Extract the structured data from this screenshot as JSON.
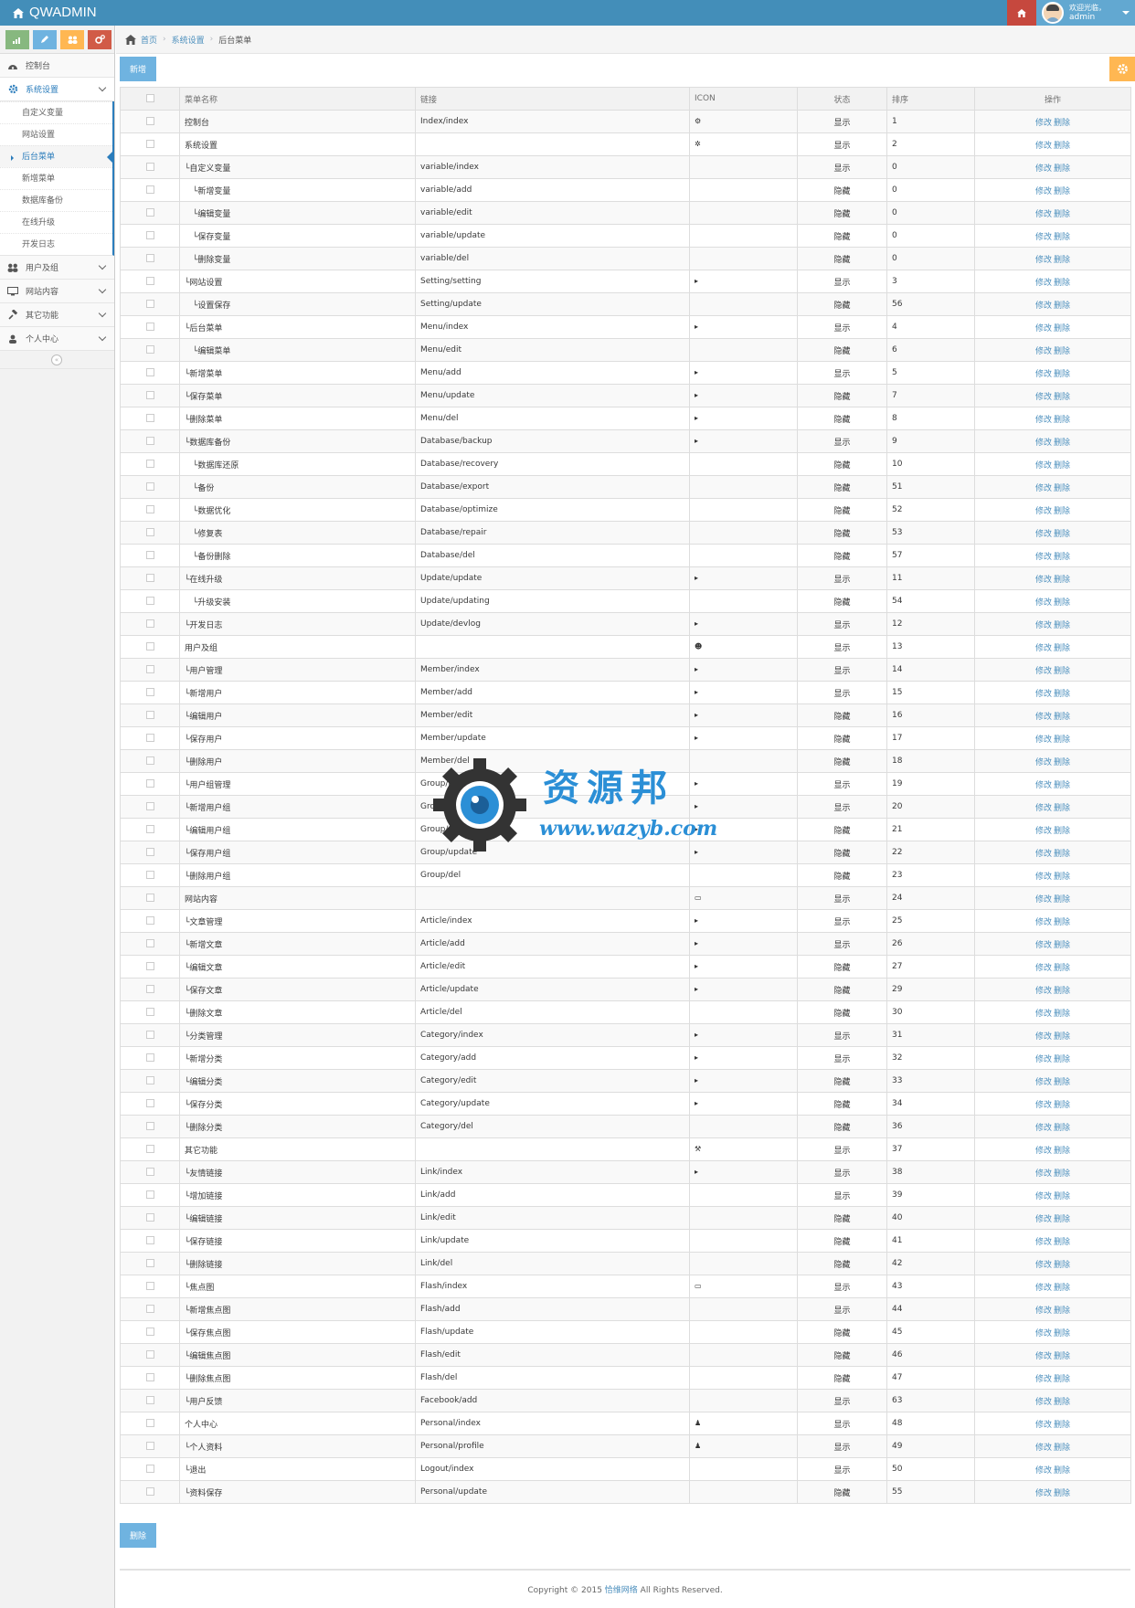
{
  "app": {
    "brand": "QWADMIN",
    "user": {
      "greeting": "欢迎光临，",
      "name": "admin"
    }
  },
  "sidebar": {
    "items": [
      {
        "label": "控制台",
        "icon": "dashboard-icon"
      },
      {
        "label": "系统设置",
        "icon": "cog-icon",
        "active": true
      },
      {
        "label": "用户及组",
        "icon": "users-icon"
      },
      {
        "label": "网站内容",
        "icon": "desktop-icon"
      },
      {
        "label": "其它功能",
        "icon": "gavel-icon"
      },
      {
        "label": "个人中心",
        "icon": "user-icon"
      }
    ],
    "submenu": [
      "自定义变量",
      "网站设置",
      "后台菜单",
      "新增菜单",
      "数据库备份",
      "在线升级",
      "开发日志"
    ],
    "collapse_symbol": "«"
  },
  "breadcrumb": {
    "home": "首页",
    "parent": "系统设置",
    "current": "后台菜单"
  },
  "buttons": {
    "new": "新增",
    "delete": "删除"
  },
  "table": {
    "headers": {
      "name": "菜单名称",
      "link": "链接",
      "icon": "ICON",
      "status": "状态",
      "order": "排序",
      "ops": "操作"
    },
    "ops": {
      "edit": "修改",
      "delete": "删除"
    },
    "rows": [
      {
        "name": "控制台",
        "link": "Index/index",
        "icon": "⚙",
        "status": "显示",
        "order": "1"
      },
      {
        "name": "系统设置",
        "link": "",
        "icon": "✲",
        "status": "显示",
        "order": "2"
      },
      {
        "name": "└自定义变量",
        "link": "variable/index",
        "icon": "",
        "status": "显示",
        "order": "0"
      },
      {
        "name": "　└新增变量",
        "link": "variable/add",
        "icon": "",
        "status": "隐藏",
        "order": "0"
      },
      {
        "name": "　└编辑变量",
        "link": "variable/edit",
        "icon": "",
        "status": "隐藏",
        "order": "0"
      },
      {
        "name": "　└保存变量",
        "link": "variable/update",
        "icon": "",
        "status": "隐藏",
        "order": "0"
      },
      {
        "name": "　└删除变量",
        "link": "variable/del",
        "icon": "",
        "status": "隐藏",
        "order": "0"
      },
      {
        "name": "└网站设置",
        "link": "Setting/setting",
        "icon": "▸",
        "status": "显示",
        "order": "3"
      },
      {
        "name": "　└设置保存",
        "link": "Setting/update",
        "icon": "",
        "status": "隐藏",
        "order": "56"
      },
      {
        "name": "└后台菜单",
        "link": "Menu/index",
        "icon": "▸",
        "status": "显示",
        "order": "4"
      },
      {
        "name": "　└编辑菜单",
        "link": "Menu/edit",
        "icon": "",
        "status": "隐藏",
        "order": "6"
      },
      {
        "name": "└新增菜单",
        "link": "Menu/add",
        "icon": "▸",
        "status": "显示",
        "order": "5"
      },
      {
        "name": "└保存菜单",
        "link": "Menu/update",
        "icon": "▸",
        "status": "隐藏",
        "order": "7"
      },
      {
        "name": "└删除菜单",
        "link": "Menu/del",
        "icon": "▸",
        "status": "隐藏",
        "order": "8"
      },
      {
        "name": "└数据库备份",
        "link": "Database/backup",
        "icon": "▸",
        "status": "显示",
        "order": "9"
      },
      {
        "name": "　└数据库还原",
        "link": "Database/recovery",
        "icon": "",
        "status": "隐藏",
        "order": "10"
      },
      {
        "name": "　└备份",
        "link": "Database/export",
        "icon": "",
        "status": "隐藏",
        "order": "51"
      },
      {
        "name": "　└数据优化",
        "link": "Database/optimize",
        "icon": "",
        "status": "隐藏",
        "order": "52"
      },
      {
        "name": "　└修复表",
        "link": "Database/repair",
        "icon": "",
        "status": "隐藏",
        "order": "53"
      },
      {
        "name": "　└备份删除",
        "link": "Database/del",
        "icon": "",
        "status": "隐藏",
        "order": "57"
      },
      {
        "name": "└在线升级",
        "link": "Update/update",
        "icon": "▸",
        "status": "显示",
        "order": "11"
      },
      {
        "name": "　└升级安装",
        "link": "Update/updating",
        "icon": "",
        "status": "隐藏",
        "order": "54"
      },
      {
        "name": "└开发日志",
        "link": "Update/devlog",
        "icon": "▸",
        "status": "显示",
        "order": "12"
      },
      {
        "name": "用户及组",
        "link": "",
        "icon": "☻",
        "status": "显示",
        "order": "13"
      },
      {
        "name": "└用户管理",
        "link": "Member/index",
        "icon": "▸",
        "status": "显示",
        "order": "14"
      },
      {
        "name": "└新增用户",
        "link": "Member/add",
        "icon": "▸",
        "status": "显示",
        "order": "15"
      },
      {
        "name": "└编辑用户",
        "link": "Member/edit",
        "icon": "▸",
        "status": "隐藏",
        "order": "16"
      },
      {
        "name": "└保存用户",
        "link": "Member/update",
        "icon": "▸",
        "status": "隐藏",
        "order": "17"
      },
      {
        "name": "└删除用户",
        "link": "Member/del",
        "icon": "",
        "status": "隐藏",
        "order": "18"
      },
      {
        "name": "└用户组管理",
        "link": "Group/index",
        "icon": "▸",
        "status": "显示",
        "order": "19"
      },
      {
        "name": "└新增用户组",
        "link": "Group/add",
        "icon": "▸",
        "status": "显示",
        "order": "20"
      },
      {
        "name": "└编辑用户组",
        "link": "Group/edit",
        "icon": "▸",
        "status": "隐藏",
        "order": "21"
      },
      {
        "name": "└保存用户组",
        "link": "Group/update",
        "icon": "▸",
        "status": "隐藏",
        "order": "22"
      },
      {
        "name": "└删除用户组",
        "link": "Group/del",
        "icon": "",
        "status": "隐藏",
        "order": "23"
      },
      {
        "name": "网站内容",
        "link": "",
        "icon": "▭",
        "status": "显示",
        "order": "24"
      },
      {
        "name": "└文章管理",
        "link": "Article/index",
        "icon": "▸",
        "status": "显示",
        "order": "25"
      },
      {
        "name": "└新增文章",
        "link": "Article/add",
        "icon": "▸",
        "status": "显示",
        "order": "26"
      },
      {
        "name": "└编辑文章",
        "link": "Article/edit",
        "icon": "▸",
        "status": "隐藏",
        "order": "27"
      },
      {
        "name": "└保存文章",
        "link": "Article/update",
        "icon": "▸",
        "status": "隐藏",
        "order": "29"
      },
      {
        "name": "└删除文章",
        "link": "Article/del",
        "icon": "",
        "status": "隐藏",
        "order": "30"
      },
      {
        "name": "└分类管理",
        "link": "Category/index",
        "icon": "▸",
        "status": "显示",
        "order": "31"
      },
      {
        "name": "└新增分类",
        "link": "Category/add",
        "icon": "▸",
        "status": "显示",
        "order": "32"
      },
      {
        "name": "└编辑分类",
        "link": "Category/edit",
        "icon": "▸",
        "status": "隐藏",
        "order": "33"
      },
      {
        "name": "└保存分类",
        "link": "Category/update",
        "icon": "▸",
        "status": "隐藏",
        "order": "34"
      },
      {
        "name": "└删除分类",
        "link": "Category/del",
        "icon": "",
        "status": "隐藏",
        "order": "36"
      },
      {
        "name": "其它功能",
        "link": "",
        "icon": "⚒",
        "status": "显示",
        "order": "37"
      },
      {
        "name": "└友情链接",
        "link": "Link/index",
        "icon": "▸",
        "status": "显示",
        "order": "38"
      },
      {
        "name": "└增加链接",
        "link": "Link/add",
        "icon": "",
        "status": "显示",
        "order": "39"
      },
      {
        "name": "└编辑链接",
        "link": "Link/edit",
        "icon": "",
        "status": "隐藏",
        "order": "40"
      },
      {
        "name": "└保存链接",
        "link": "Link/update",
        "icon": "",
        "status": "隐藏",
        "order": "41"
      },
      {
        "name": "└删除链接",
        "link": "Link/del",
        "icon": "",
        "status": "隐藏",
        "order": "42"
      },
      {
        "name": "└焦点图",
        "link": "Flash/index",
        "icon": "▭",
        "status": "显示",
        "order": "43"
      },
      {
        "name": "└新增焦点图",
        "link": "Flash/add",
        "icon": "",
        "status": "显示",
        "order": "44"
      },
      {
        "name": "└保存焦点图",
        "link": "Flash/update",
        "icon": "",
        "status": "隐藏",
        "order": "45"
      },
      {
        "name": "└编辑焦点图",
        "link": "Flash/edit",
        "icon": "",
        "status": "隐藏",
        "order": "46"
      },
      {
        "name": "└删除焦点图",
        "link": "Flash/del",
        "icon": "",
        "status": "隐藏",
        "order": "47"
      },
      {
        "name": "└用户反馈",
        "link": "Facebook/add",
        "icon": "",
        "status": "显示",
        "order": "63"
      },
      {
        "name": "个人中心",
        "link": "Personal/index",
        "icon": "♟",
        "status": "显示",
        "order": "48"
      },
      {
        "name": "└个人资料",
        "link": "Personal/profile",
        "icon": "♟",
        "status": "显示",
        "order": "49"
      },
      {
        "name": "└退出",
        "link": "Logout/index",
        "icon": "",
        "status": "显示",
        "order": "50"
      },
      {
        "name": "└资料保存",
        "link": "Personal/update",
        "icon": "",
        "status": "隐藏",
        "order": "55"
      }
    ]
  },
  "footer": {
    "prefix": "Copyright © 2015 ",
    "company": "恰维网络",
    "suffix": " All Rights Reserved."
  },
  "watermark": {
    "title": "资源邦",
    "url": "www.wazyb.com"
  },
  "colors": {
    "navbar": "#438eb9",
    "accent": "#6fb3e0",
    "link": "#4c8fbd",
    "danger": "#c6483e",
    "warning": "#ffb752",
    "success": "#87b87f"
  }
}
